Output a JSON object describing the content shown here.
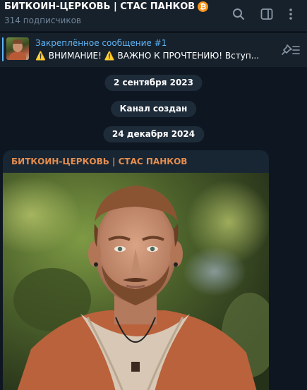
{
  "header": {
    "channel_title": "БИТКОИН-ЦЕРКОВЬ | СТАС ПАНКОВ",
    "bitcoin_glyph": "₿",
    "subscribers": "314 подписчиков",
    "icons": [
      "search-icon",
      "sidebar-toggle-icon",
      "more-vertical-icon"
    ]
  },
  "pinned": {
    "title": "Закреплённое сообщение #1",
    "text": "⚠️ ВНИМАНИЕ! ⚠️  ВАЖНО К ПРОЧТЕНИЮ!   Вступ...",
    "icon": "unpin-list-icon"
  },
  "timeline": {
    "date1": "2 сентября 2023",
    "service": "Канал создан",
    "date2": "24 декабря 2024"
  },
  "message": {
    "author": "БИТКОИН-ЦЕРКОВЬ | СТАС ПАНКОВ",
    "photo_alt": "photo"
  },
  "colors": {
    "background": "#0e1621",
    "header": "#17212b",
    "accent": "#5eb5f7",
    "author": "#e58e4e",
    "bitcoin": "#f7931a"
  }
}
